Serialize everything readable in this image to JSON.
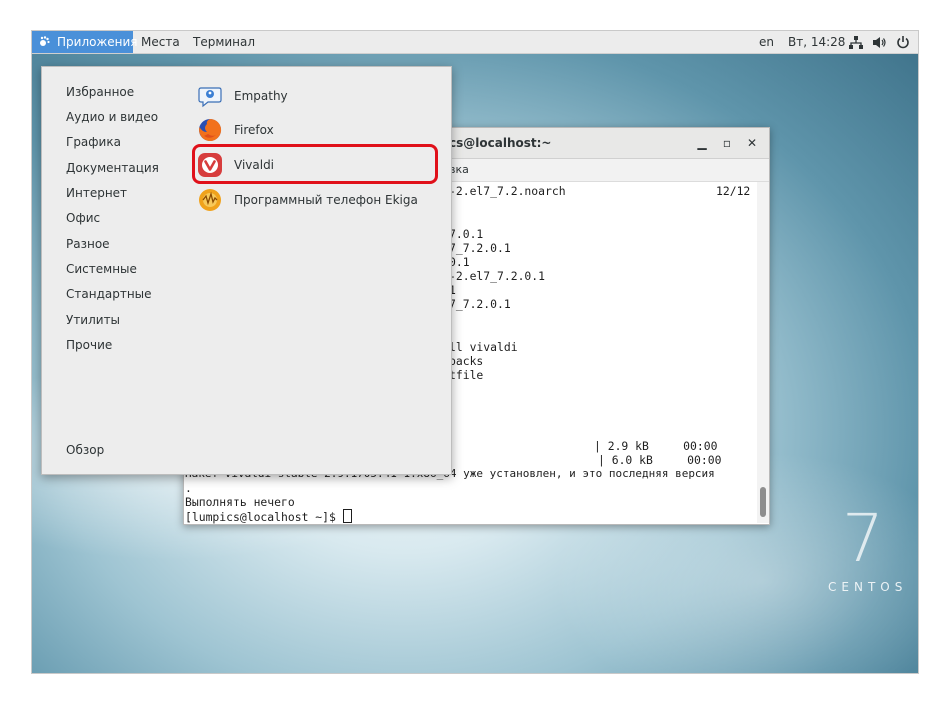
{
  "topbar": {
    "applications": "Приложения",
    "places": "Места",
    "terminal": "Терминал",
    "language": "en",
    "clock": "Вт, 14:28"
  },
  "terminal": {
    "title": "cs@localhost:~",
    "menu_tail": "вка",
    "lines": [
      "-2.el7_7.2.noarch",
      "12/12",
      "7.0.1",
      "7_7.2.0.1",
      "0.1",
      "-2.el7_7.2.0.1",
      "1",
      "7_7.2.0.1",
      "ll vivaldi",
      "packs",
      "tfile",
      "| 2.9 kB     00:00",
      "| 6.0 kB     00:00",
      "Пакет vivaldi-stable-2.9.1705.41-1.x86_64 уже установлен, и это последняя версия",
      ".",
      "Выполнять нечего",
      "[lumpics@localhost ~]$ "
    ]
  },
  "menu": {
    "categories": [
      "Избранное",
      "Аудио и видео",
      "Графика",
      "Документация",
      "Интернет",
      "Офис",
      "Разное",
      "Системные",
      "Стандартные",
      "Утилиты",
      "Прочие"
    ],
    "overview": "Обзор",
    "apps": [
      {
        "label": "Empathy",
        "icon": "empathy-icon"
      },
      {
        "label": "Firefox",
        "icon": "firefox-icon"
      },
      {
        "label": "Vivaldi",
        "icon": "vivaldi-icon"
      },
      {
        "label": "Программный телефон Ekiga",
        "icon": "ekiga-icon"
      }
    ],
    "highlight_color": "#e0101a"
  },
  "centos": {
    "number": "7",
    "label": "CENTOS"
  },
  "colors": {
    "accent": "#4a90d9"
  }
}
